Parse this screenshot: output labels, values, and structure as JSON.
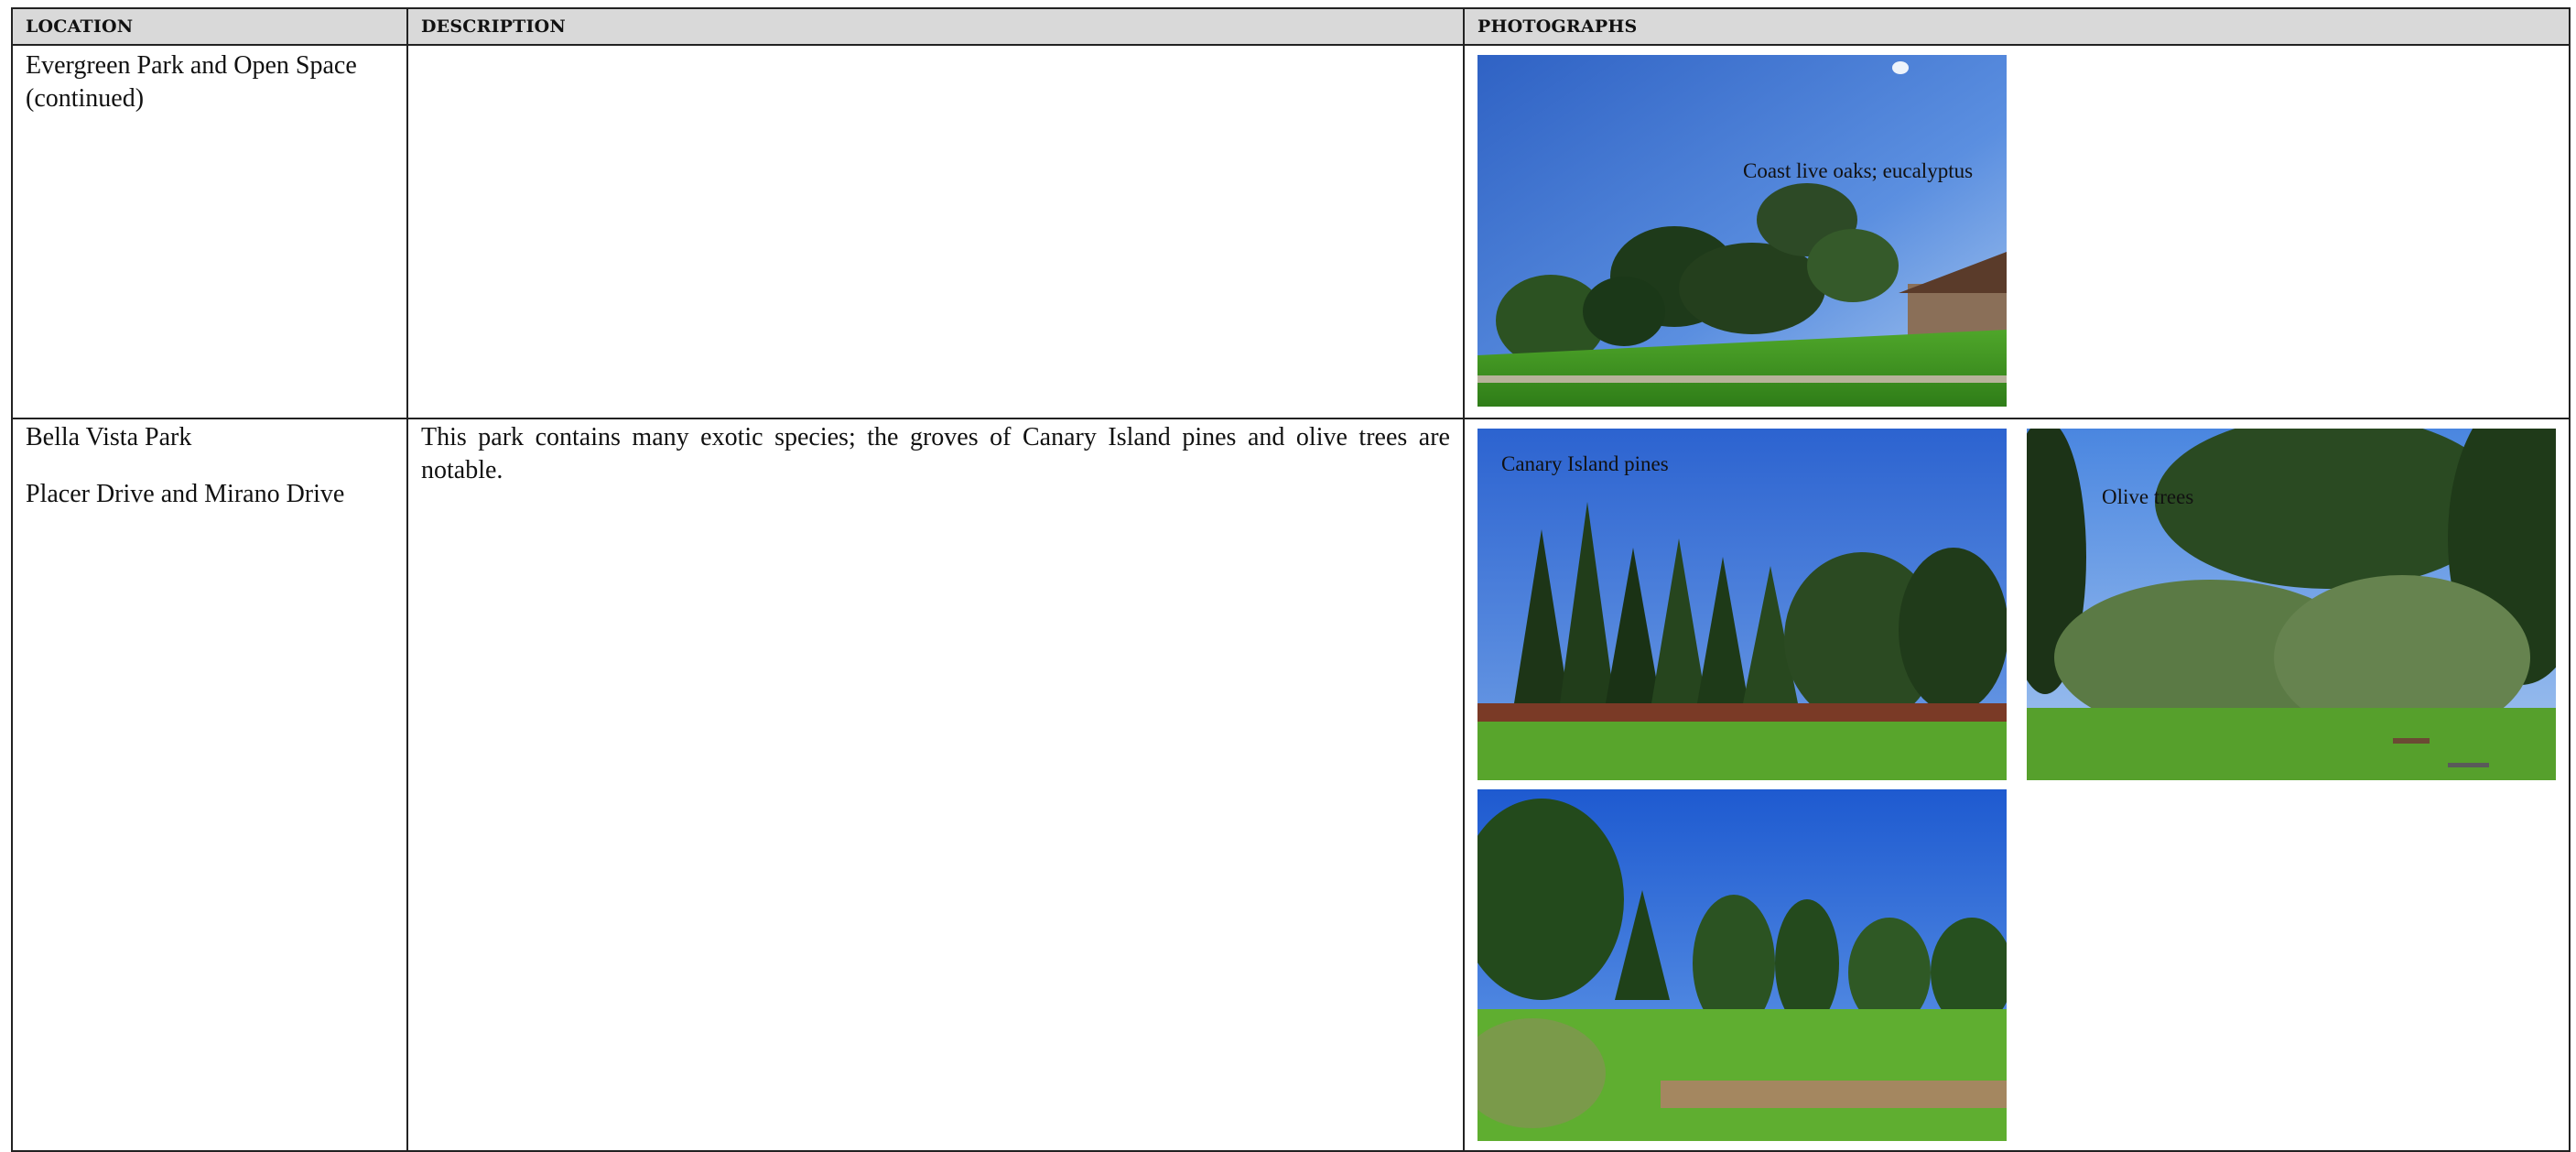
{
  "headers": {
    "location": "LOCATION",
    "description": "DESCRIPTION",
    "photographs": "PHOTOGRAPHS"
  },
  "rows": [
    {
      "location_lines": [
        "Evergreen Park and Open Space",
        "(continued)"
      ],
      "description": "",
      "photos": [
        {
          "caption": "Coast live oaks; eucalyptus"
        }
      ]
    },
    {
      "location_lines": [
        "Bella Vista Park",
        "Placer Drive and Mirano Drive"
      ],
      "description": "This park contains many exotic species; the groves of Canary Island pines and olive trees are notable.",
      "photos": [
        {
          "caption": "Canary Island pines"
        },
        {
          "caption": "Olive trees"
        },
        {
          "caption": ""
        }
      ]
    }
  ]
}
